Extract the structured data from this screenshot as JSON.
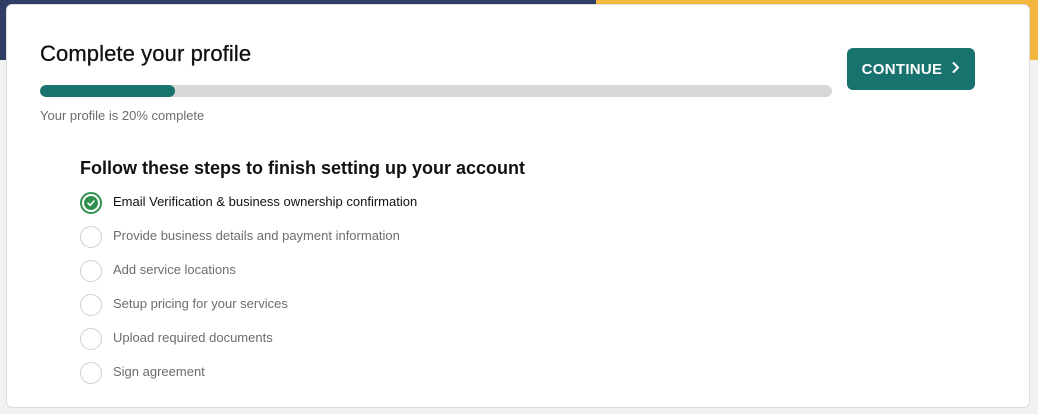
{
  "colors": {
    "accent": "#18736f",
    "banner_blue": "#2e3e64",
    "banner_yellow": "#f3b73d",
    "done": "#2f8f4e"
  },
  "header": {
    "title": "Complete your profile",
    "progress_fraction": 0.17,
    "progress_text": "Your profile is 20% complete",
    "continue_label": "CONTINUE",
    "continue_icon": "chevron-right-icon"
  },
  "steps": {
    "heading": "Follow these steps to finish setting up your account",
    "items": [
      {
        "label": "Email Verification & business ownership confirmation",
        "done": true
      },
      {
        "label": "Provide business details and payment information",
        "done": false
      },
      {
        "label": "Add service locations",
        "done": false
      },
      {
        "label": "Setup pricing for your services",
        "done": false
      },
      {
        "label": "Upload required documents",
        "done": false
      },
      {
        "label": "Sign agreement",
        "done": false
      }
    ]
  }
}
